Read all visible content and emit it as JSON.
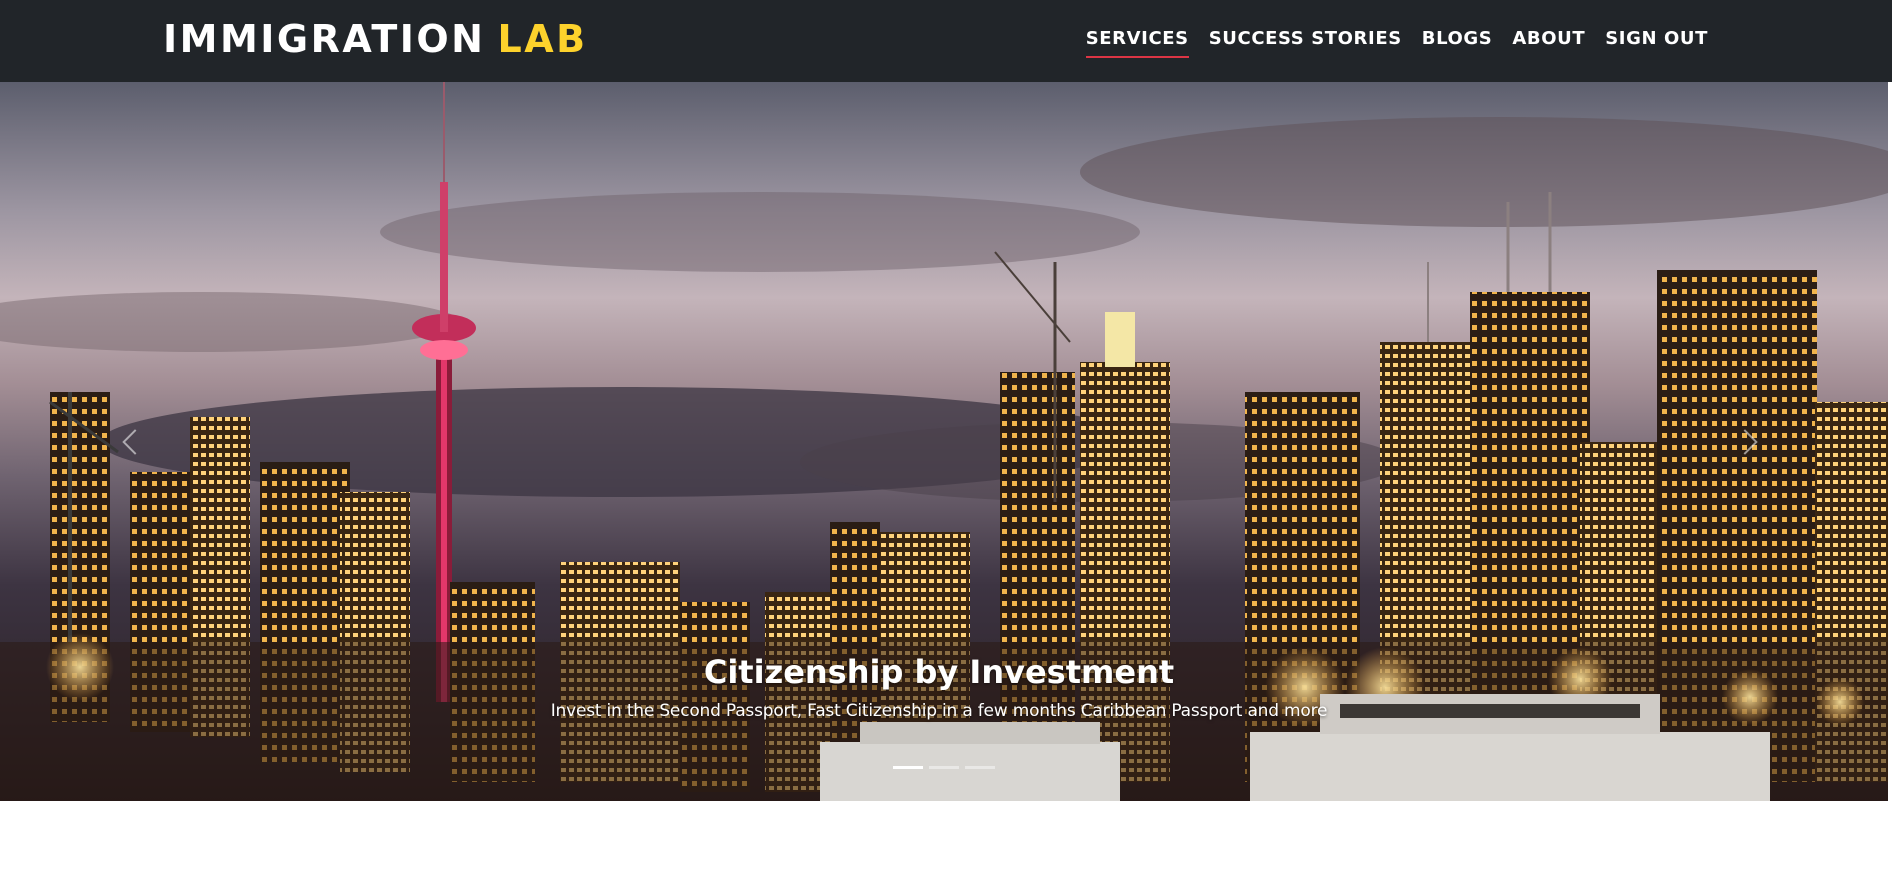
{
  "navbar": {
    "brand_main": "IMMIGRATION",
    "brand_accent": "LAB",
    "items": [
      {
        "label": "SERVICES",
        "active": true
      },
      {
        "label": "SUCCESS STORIES",
        "active": false
      },
      {
        "label": "BLOGS",
        "active": false
      },
      {
        "label": "ABOUT",
        "active": false
      },
      {
        "label": "SIGN OUT",
        "active": false
      }
    ]
  },
  "hero": {
    "title": "Citizenship by Investment",
    "subtitle": "Invest in the Second Passport, Fast Citizenship in a few months Caribbean Passport and more",
    "slide_count": 3,
    "active_slide": 1,
    "prev_icon": "chevron-left-icon",
    "next_icon": "chevron-right-icon"
  },
  "colors": {
    "navbar_bg": "#212529",
    "brand_accent": "#fdd22c",
    "active_underline": "#dc3545"
  }
}
